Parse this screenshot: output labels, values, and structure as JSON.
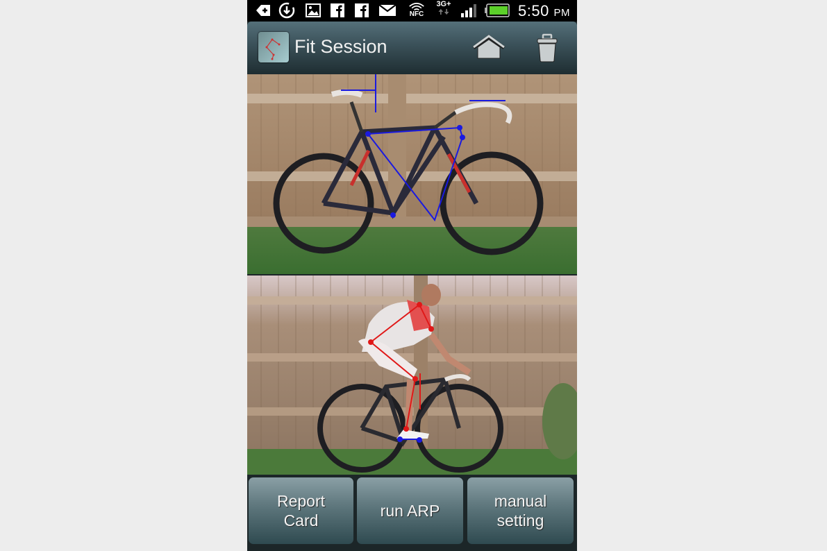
{
  "status_bar": {
    "icons": [
      "back-arrow-icon",
      "download-sync-icon",
      "gallery-icon",
      "facebook-icon",
      "facebook-icon",
      "mail-icon",
      "wifi-nfc-icon",
      "3g-plus-data-icon",
      "signal-icon",
      "battery-icon"
    ],
    "nfc_label": "NFC",
    "network_label": "3G+",
    "time": "5:50",
    "ampm": "PM"
  },
  "action_bar": {
    "title": "Fit Session",
    "home_icon": "home-icon",
    "delete_icon": "trash-icon"
  },
  "photos": [
    {
      "name": "bike-photo",
      "overlay_color": "#1a1ae0"
    },
    {
      "name": "rider-photo",
      "overlay_color": "#e01818",
      "secondary_overlay_color": "#1a1ae0"
    }
  ],
  "buttons": {
    "report_card": "Report\nCard",
    "run_arp": "run ARP",
    "manual_setting": "manual\nsetting"
  },
  "colors": {
    "page_bg": "#ededed",
    "status_bar_bg": "#000000",
    "action_bar_top": "#55707a",
    "action_bar_bottom": "#1e2d31",
    "button_top": "#8a9fa5",
    "button_bottom": "#2f4a50"
  }
}
